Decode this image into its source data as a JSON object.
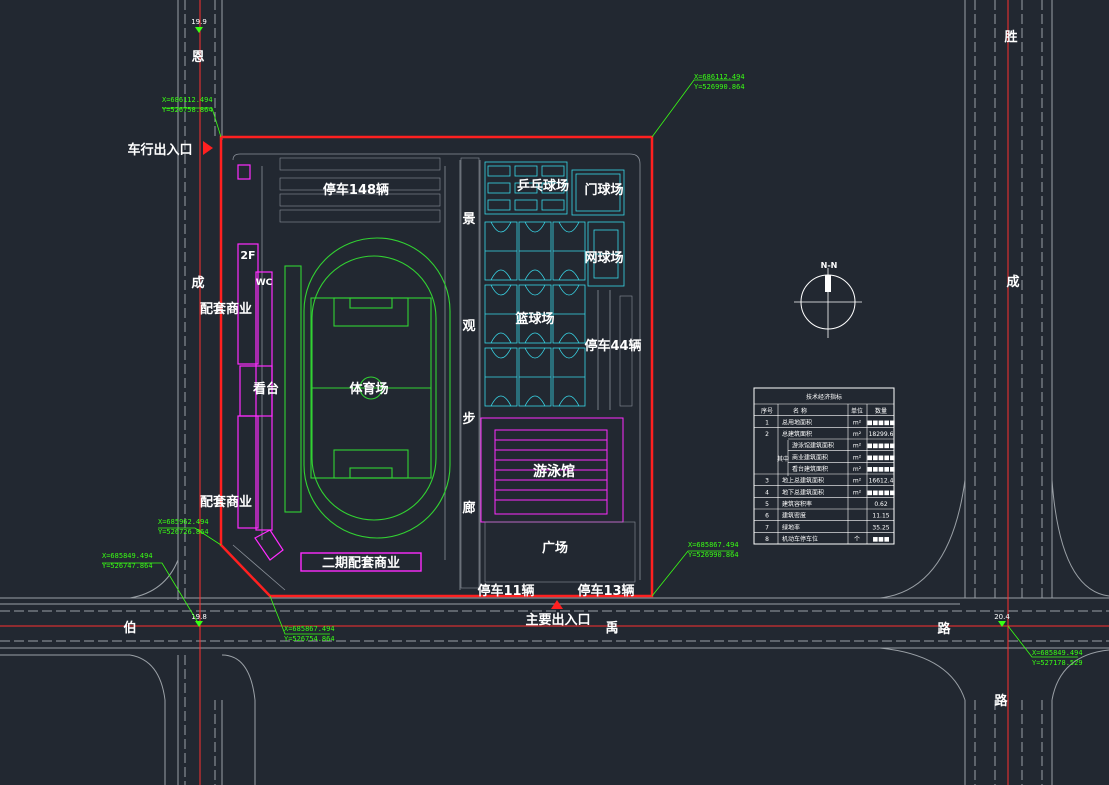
{
  "colors": {
    "background": "#222831",
    "road_line": "#9aa0a6",
    "boundary": "#ff2020",
    "track": "#32d232",
    "court": "#39d7e8",
    "building": "#ff2cff",
    "leader": "#39ff14",
    "axis": "#ff3030"
  },
  "labels": {
    "vehicle_entrance": "车行出入口",
    "main_entrance": "主要出入口",
    "parking_148": "停车148辆",
    "table_tennis": "乒乓球场",
    "gate_court": "门球场",
    "tennis": "网球场",
    "basketball": "篮球场",
    "parking_44": "停车44辆",
    "stadium": "体育场",
    "stand": "看台",
    "swimming": "游泳馆",
    "plaza": "广场",
    "parking_11": "停车11辆",
    "parking_13": "停车13辆",
    "phase2_commercial": "二期配套商业",
    "commercial_upper": "配套商业",
    "commercial_lower": "配套商业",
    "two_f": "2F",
    "wc": "WC",
    "promenade": [
      "景",
      "观",
      "步",
      "廊"
    ]
  },
  "roads": {
    "left_top": "恩",
    "left_mid": "成",
    "right_top": "胜",
    "right_mid": "成",
    "bottom_1": "伯",
    "bottom_2": "禹",
    "bottom_3": "路",
    "right_bottom": "路"
  },
  "elevations": {
    "top": "19.9",
    "bottom_left": "19.8",
    "bottom_right": "20.4"
  },
  "coordinates": {
    "c1": [
      "X=686112.494",
      "Y=526758.864"
    ],
    "c2": [
      "X=686112.494",
      "Y=526990.864"
    ],
    "c3": [
      "X=685962.494",
      "Y=526726.864"
    ],
    "c4": [
      "X=685849.494",
      "Y=526747.864"
    ],
    "c5": [
      "X=685867.494",
      "Y=526754.864"
    ],
    "c6": [
      "X=685867.494",
      "Y=526990.864"
    ],
    "c7": [
      "X=685849.494",
      "Y=527178.529"
    ]
  },
  "north_arrow": {
    "label": "N-N"
  },
  "table": {
    "title": "技术经济指标",
    "headers": [
      "序号",
      "名 称",
      "单位",
      "数量"
    ],
    "rows": [
      {
        "no": "1",
        "name": "总用地面积",
        "unit": "m²",
        "qty": "■■■■■"
      },
      {
        "no": "2",
        "name": "总建筑面积",
        "unit": "m²",
        "qty": "18299.6"
      },
      {
        "no": "",
        "name": "游泳馆建筑面积",
        "unit": "m²",
        "qty": "■■■■■"
      },
      {
        "no": "",
        "name": "商业建筑面积",
        "unit": "m²",
        "qty": "■■■■■"
      },
      {
        "no": "",
        "name": "看台建筑面积",
        "unit": "m²",
        "qty": "■■■■■"
      },
      {
        "no": "3",
        "name": "地上总建筑面积",
        "unit": "m²",
        "qty": "16612.4"
      },
      {
        "no": "4",
        "name": "地下总建筑面积",
        "unit": "m²",
        "qty": "■■■■■"
      },
      {
        "no": "5",
        "name": "建筑容积率",
        "unit": "",
        "qty": "0.62"
      },
      {
        "no": "6",
        "name": "建筑密度",
        "unit": "",
        "qty": "11.15"
      },
      {
        "no": "7",
        "name": "绿地率",
        "unit": "",
        "qty": "35.25"
      },
      {
        "no": "8",
        "name": "机动车停车位",
        "unit": "个",
        "qty": "■■■"
      }
    ],
    "group_label": "其中"
  }
}
